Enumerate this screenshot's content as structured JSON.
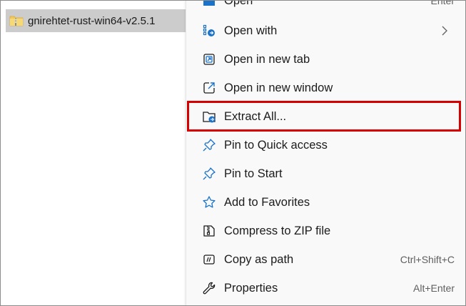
{
  "file": {
    "name": "gnirehtet-rust-win64-v2.5.1",
    "icon": "zip-folder-icon"
  },
  "menu": {
    "items": [
      {
        "label": "Open",
        "shortcut": "Enter",
        "icon": "open-icon"
      },
      {
        "label": "Open with",
        "shortcut": "",
        "icon": "open-with-icon",
        "submenu": true
      },
      {
        "label": "Open in new tab",
        "shortcut": "",
        "icon": "new-tab-icon"
      },
      {
        "label": "Open in new window",
        "shortcut": "",
        "icon": "new-window-icon"
      },
      {
        "label": "Extract All...",
        "shortcut": "",
        "icon": "extract-all-icon",
        "highlighted": true
      },
      {
        "label": "Pin to Quick access",
        "shortcut": "",
        "icon": "pin-icon"
      },
      {
        "label": "Pin to Start",
        "shortcut": "",
        "icon": "pin-icon"
      },
      {
        "label": "Add to Favorites",
        "shortcut": "",
        "icon": "star-icon"
      },
      {
        "label": "Compress to ZIP file",
        "shortcut": "",
        "icon": "zip-icon"
      },
      {
        "label": "Copy as path",
        "shortcut": "Ctrl+Shift+C",
        "icon": "copy-path-icon"
      },
      {
        "label": "Properties",
        "shortcut": "Alt+Enter",
        "icon": "wrench-icon"
      }
    ]
  },
  "colors": {
    "highlight_border": "#d60000",
    "icon_blue": "#1a73c9",
    "selection_bg": "#cccccc"
  }
}
